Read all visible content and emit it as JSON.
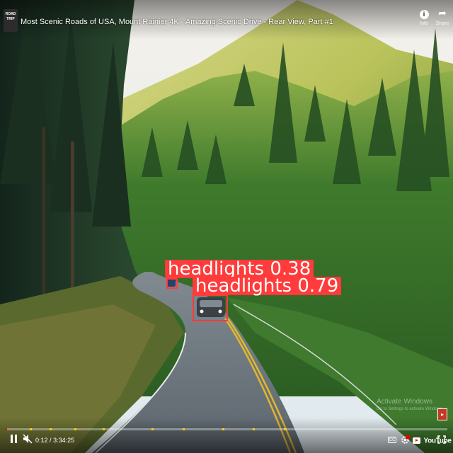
{
  "player": {
    "title": "Most Scenic Roads of USA, Mount Rainier 4K - Amazing Scenic Drive - Rear View, Part #1",
    "channel_badge": "ROAD TRIP",
    "info_label": "Info",
    "share_label": "Share",
    "current_time": "0:12",
    "duration": "3:34:25",
    "progress_fraction": 0.001,
    "chapter_marks": [
      0.055,
      0.1,
      0.155,
      0.22,
      0.33,
      0.4,
      0.49,
      0.56,
      0.63
    ],
    "cc_label": "CC",
    "logo_text": "YouTube",
    "accent_color": "#ff0000"
  },
  "detections": [
    {
      "label": "headlights 0.38",
      "class": "headlights",
      "confidence": 0.38
    },
    {
      "label": "headlights 0.79",
      "class": "headlights",
      "confidence": 0.79
    }
  ],
  "watermark": {
    "line1": "Activate Windows",
    "line2": "Go to Settings to activate Windows."
  },
  "colors": {
    "detection": "#ff3b3b",
    "sky": "#e9eef0",
    "forest": "#2f6b2c",
    "road": "#6f7a82"
  }
}
